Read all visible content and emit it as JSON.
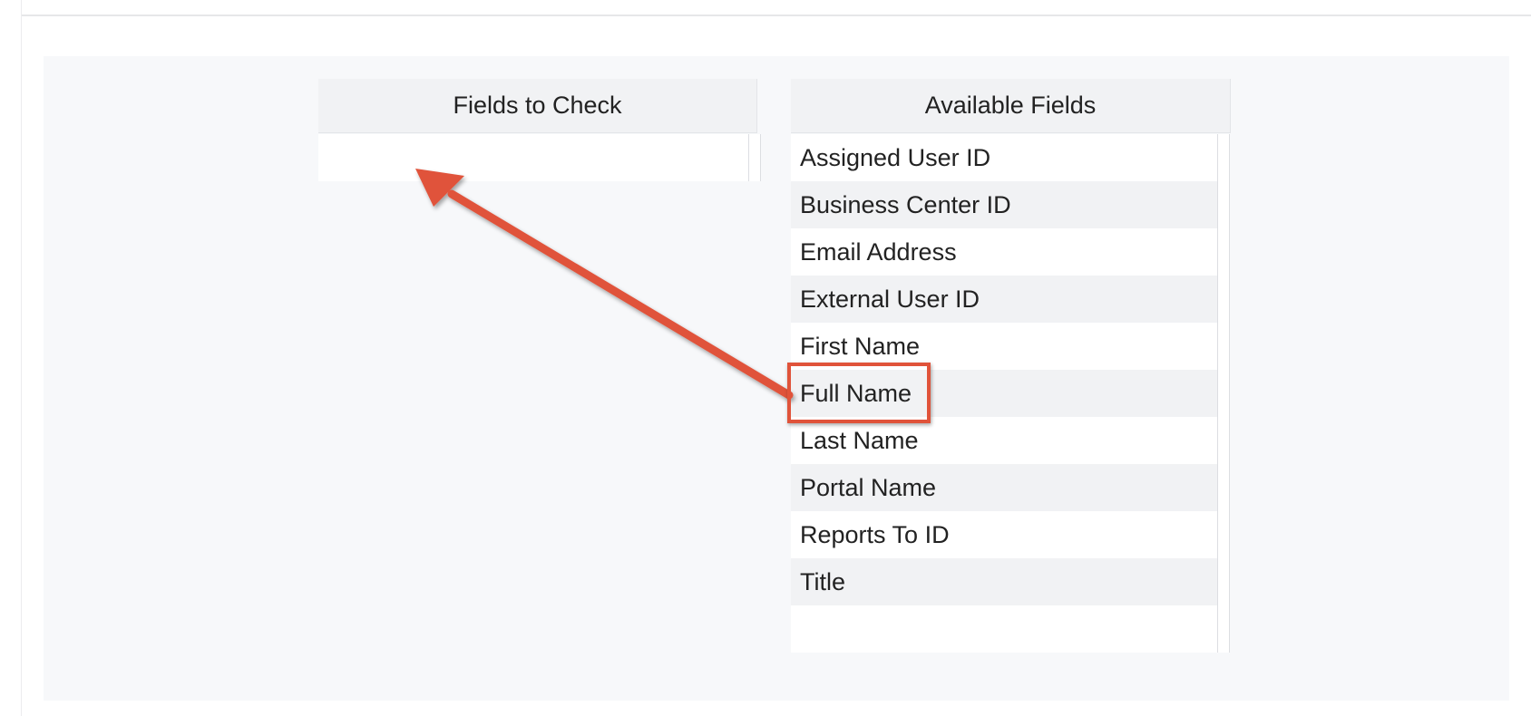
{
  "fields_to_check": {
    "header": "Fields to Check",
    "items": []
  },
  "available_fields": {
    "header": "Available Fields",
    "items": [
      "Assigned User ID",
      "Business Center ID",
      "Email Address",
      "External User ID",
      "First Name",
      "Full Name",
      "Last Name",
      "Portal Name",
      "Reports To ID",
      "Title"
    ]
  },
  "annotation": {
    "highlighted_field": "Full Name",
    "color": "#e0533a"
  },
  "colors": {
    "panel_background": "#f7f8fa",
    "header_background": "#f1f2f4",
    "row_alt_background": "#f1f2f4"
  }
}
